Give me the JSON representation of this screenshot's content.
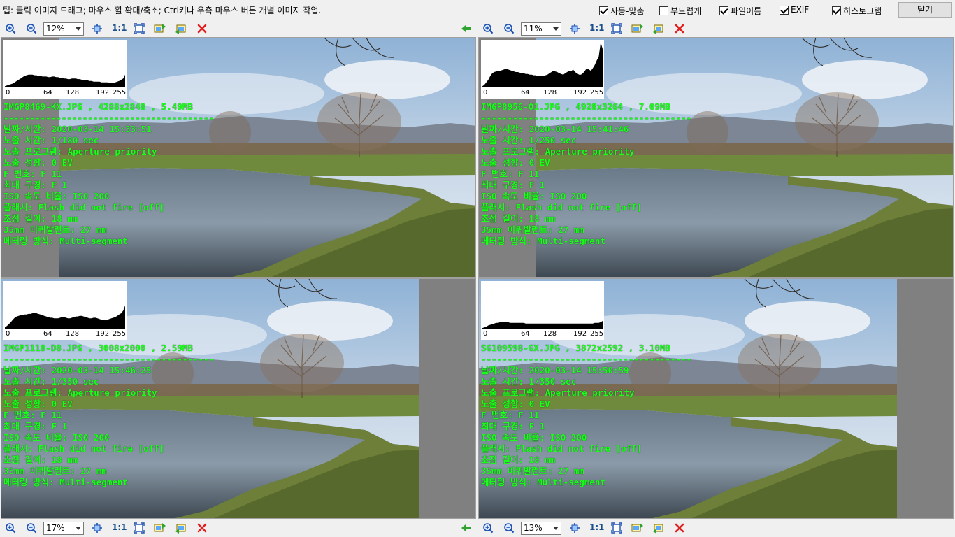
{
  "tip": "팁: 클릭 이미지 드래그; 마우스 휠 확대/축소; Ctrl키나 우측 마우스 버튼 개별 이미지 작업.",
  "options": [
    {
      "label": "자동-맞춤",
      "checked": true
    },
    {
      "label": "부드럽게",
      "checked": false
    },
    {
      "label": "파일이름",
      "checked": true
    },
    {
      "label": "EXIF",
      "checked": true
    },
    {
      "label": "히스토그램",
      "checked": true
    }
  ],
  "close_label": "닫기",
  "one_to_one": "1:1",
  "histogram_ticks": [
    "0",
    "64",
    "128",
    "192",
    "255"
  ],
  "exif_labels": {
    "datetime": "날짜/시간",
    "exposure_time": "노출 시간",
    "exposure_program": "노출 프로그램",
    "exposure_bias": "노출 성향",
    "f_number": "F 번호",
    "max_aperture": "최대 구경",
    "iso": "ISO 속도 비율",
    "flash": "플래시",
    "focal_length": "초점 길이",
    "focal_35mm": "35mm 이퀴발런트",
    "metering": "메터링 방식"
  },
  "panels": [
    {
      "zoom": "12%",
      "file": "IMGP8469-KX.JPG , 4288x2848 , 5.49MB",
      "separator": "----------------------------------------",
      "datetime": "2020-03-14 15:33:51",
      "exposure_time": "1/180 sec",
      "exposure_program": "Aperture priority",
      "exposure_bias": "0 EV",
      "f_number": "F 11",
      "max_aperture": "F 1",
      "iso": "ISO 200",
      "flash": "Flash did not fire [off]",
      "focal_length": "18 mm",
      "focal_35mm": "27 mm",
      "metering": "Multi-segment",
      "hist": [
        2,
        3,
        4,
        5,
        6,
        8,
        10,
        12,
        14,
        16,
        18,
        19,
        20,
        20,
        20,
        19,
        19,
        18,
        18,
        17,
        17,
        17,
        16,
        16,
        17,
        17,
        16,
        16,
        15,
        15,
        14,
        14,
        13,
        13,
        14,
        14,
        14,
        13,
        13,
        12,
        12,
        11,
        11,
        10,
        10,
        9,
        9,
        9,
        9,
        8,
        8,
        8,
        8,
        7,
        7,
        7,
        8,
        9,
        10,
        12,
        14,
        20
      ]
    },
    {
      "zoom": "11%",
      "file": "IMGP8956-01.JPG , 4928x3264 , 7.09MB",
      "separator": "----------------------------------------",
      "datetime": "2020-03-14 15:41:46",
      "exposure_time": "1/250 sec",
      "exposure_program": "Aperture priority",
      "exposure_bias": "0 EV",
      "f_number": "F 11",
      "max_aperture": "F 1",
      "iso": "ISO 200",
      "flash": "Flash did not fire [off]",
      "focal_length": "18 mm",
      "focal_35mm": "27 mm",
      "metering": "Multi-segment",
      "hist": [
        2,
        4,
        8,
        12,
        18,
        22,
        24,
        25,
        26,
        26,
        27,
        28,
        29,
        28,
        27,
        26,
        25,
        24,
        24,
        23,
        22,
        22,
        21,
        21,
        20,
        20,
        19,
        19,
        18,
        18,
        18,
        18,
        19,
        20,
        22,
        24,
        26,
        25,
        24,
        22,
        21,
        20,
        22,
        24,
        26,
        25,
        28,
        24,
        22,
        20,
        20,
        22,
        26,
        30,
        28,
        26,
        30,
        35,
        42,
        48,
        70,
        60
      ]
    },
    {
      "zoom": "17%",
      "file": "IMGP1118-D8.JPG , 3008x2000 , 2.59MB",
      "separator": "----------------------------------------",
      "datetime": "2020-03-14 15:46:25",
      "exposure_time": "1/350 sec",
      "exposure_program": "Aperture priority",
      "exposure_bias": "0 EV",
      "f_number": "F 11",
      "max_aperture": "F 1",
      "iso": "ISO 200",
      "flash": "Flash did not fire [off]",
      "focal_length": "18 mm",
      "focal_35mm": "27 mm",
      "metering": "Multi-segment",
      "hist": [
        2,
        4,
        7,
        10,
        14,
        17,
        19,
        20,
        21,
        21,
        22,
        22,
        23,
        23,
        24,
        24,
        24,
        23,
        22,
        21,
        20,
        19,
        18,
        17,
        17,
        16,
        16,
        16,
        17,
        18,
        18,
        17,
        16,
        16,
        17,
        18,
        19,
        19,
        20,
        20,
        19,
        18,
        17,
        16,
        16,
        17,
        17,
        16,
        15,
        14,
        14,
        13,
        14,
        15,
        16,
        17,
        18,
        20,
        22,
        24,
        28,
        36
      ]
    },
    {
      "zoom": "13%",
      "file": "SG109598-GX.JPG , 3872x2592 , 3.10MB",
      "separator": "----------------------------------------",
      "datetime": "2020-03-14 15:50:59",
      "exposure_time": "1/350 sec",
      "exposure_program": "Aperture priority",
      "exposure_bias": "0 EV",
      "f_number": "F 11",
      "max_aperture": "F 1",
      "iso": "ISO 200",
      "flash": "Flash did not fire [off]",
      "focal_length": "18 mm",
      "focal_35mm": "27 mm",
      "metering": "Multi-segment",
      "hist": [
        1,
        2,
        3,
        5,
        6,
        7,
        8,
        9,
        9,
        10,
        10,
        10,
        10,
        10,
        9,
        9,
        9,
        9,
        9,
        9,
        9,
        9,
        8,
        8,
        8,
        8,
        8,
        8,
        8,
        8,
        8,
        8,
        8,
        8,
        8,
        8,
        8,
        8,
        8,
        8,
        8,
        8,
        8,
        8,
        8,
        8,
        8,
        8,
        8,
        8,
        8,
        8,
        8,
        8,
        8,
        8,
        8,
        9,
        9,
        9,
        10,
        12
      ]
    }
  ],
  "colors": {
    "overlay_text": "#1aff1a",
    "panel_bg": "#808080",
    "close_x": "#e02020"
  }
}
